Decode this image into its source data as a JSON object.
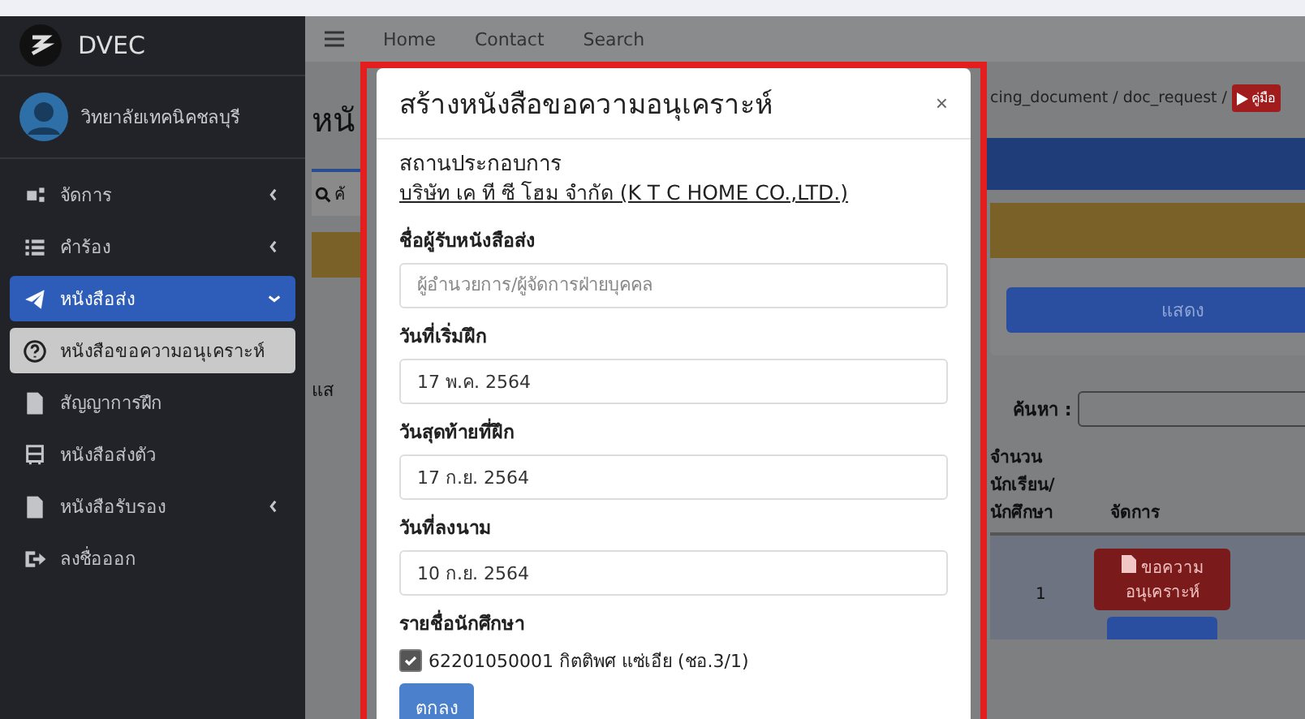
{
  "brand": {
    "name": "DVEC"
  },
  "user": {
    "name": "วิทยาลัยเทคนิคชลบุรี"
  },
  "sidebar": {
    "items": [
      {
        "label": "จัดการ",
        "kind": "group",
        "expanded": false,
        "selected": false
      },
      {
        "label": "คำร้อง",
        "kind": "group",
        "expanded": false,
        "selected": false
      },
      {
        "label": "หนังสือส่ง",
        "kind": "group",
        "expanded": true,
        "selected": true,
        "children": [
          {
            "label": "หนังสือขอความอนุเคราะห์",
            "selected": true
          },
          {
            "label": "สัญญาการฝึก",
            "selected": false
          },
          {
            "label": "หนังสือส่งตัว",
            "selected": false
          }
        ]
      },
      {
        "label": "หนังสือรับรอง",
        "kind": "group",
        "expanded": false,
        "selected": false
      },
      {
        "label": "ลงชื่อออก",
        "kind": "link",
        "selected": false
      }
    ]
  },
  "topbar": {
    "links": [
      "Home",
      "Contact",
      "Search"
    ]
  },
  "page": {
    "title_fragment": "หนั",
    "tab_fragment": "ค้",
    "entries_fragment": "แส",
    "breadcrumb": "cing_document / doc_request /",
    "manual_badge": "คู่มือ",
    "show_button": "แสดง",
    "search_label": "ค้นหา :",
    "table": {
      "columns": [
        "จำนวน นักเรียน/ นักศึกษา",
        "จัดการ"
      ],
      "rows": [
        {
          "count": "1",
          "action": "ขอความ อนุเคราะห์"
        }
      ]
    }
  },
  "modal": {
    "title": "สร้างหนังสือขอความอนุเคราะห์",
    "close": "×",
    "company_label": "สถานประกอบการ",
    "company_name": "บริษัท เค ที ซี โฮม จำกัด (K T C HOME CO.,LTD.)",
    "fields": [
      {
        "label": "ชื่อผู้รับหนังสือส่ง",
        "placeholder": "ผู้อำนวยการ/ผู้จัดการฝ่ายบุคคล"
      },
      {
        "label": "วันที่เริ่มฝึก",
        "value": "17 พ.ค. 2564"
      },
      {
        "label": "วันสุดท้ายที่ฝึก",
        "value": "17 ก.ย. 2564"
      },
      {
        "label": "วันที่ลงนาม",
        "value": "10 ก.ย. 2564"
      }
    ],
    "students_label": "รายชื่อนักศึกษา",
    "students": [
      {
        "label": "62201050001 กิตติพศ แซ่เอีย (ชอ.3/1)",
        "checked": true
      }
    ],
    "submit": "ตกลง"
  }
}
